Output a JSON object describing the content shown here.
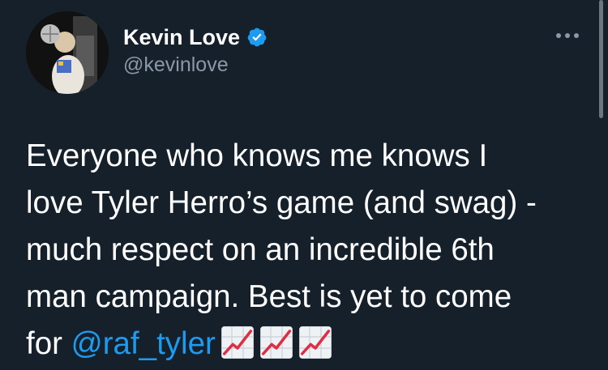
{
  "author": {
    "display_name": "Kevin Love",
    "handle": "@kevinlove",
    "verified": true,
    "avatar_icon": "avatar-photo"
  },
  "menu": {
    "icon": "more-horizontal-icon"
  },
  "tweet": {
    "lines": [
      "Everyone who knows me knows I",
      "love Tyler Herro’s game (and swag) -",
      "much respect on an incredible 6th",
      "man campaign. Best is yet to come"
    ],
    "last_line_prefix": "for ",
    "mention": "@raf_tyler",
    "emojis": [
      "chart-increasing",
      "chart-increasing",
      "chart-increasing"
    ]
  },
  "colors": {
    "background": "#15202b",
    "text": "#ffffff",
    "secondary_text": "#8b98a5",
    "link": "#1d9bf0",
    "verified_badge": "#1d9bf0"
  }
}
